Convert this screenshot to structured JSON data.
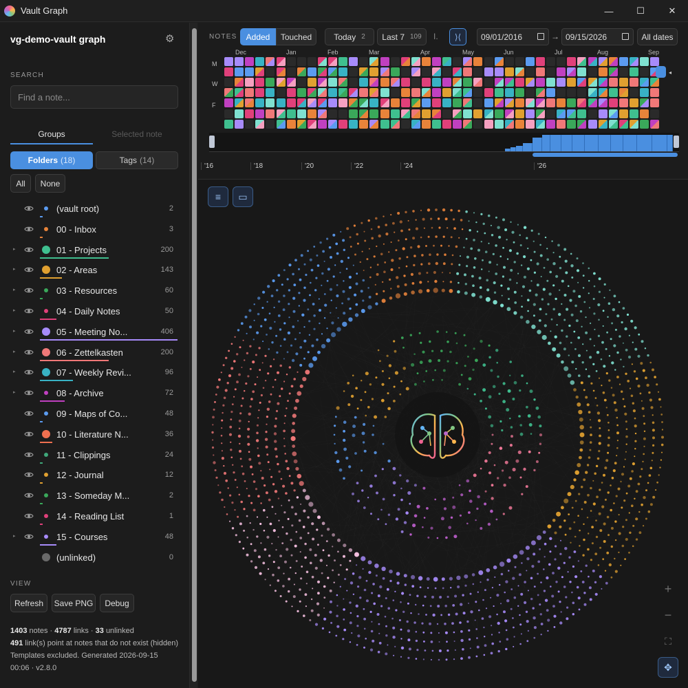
{
  "window": {
    "title": "Vault Graph",
    "min": "—",
    "max": "☐",
    "close": "✕"
  },
  "sidebar": {
    "vault_title": "vg-demo-vault graph",
    "search": {
      "label": "SEARCH",
      "placeholder": "Find a note..."
    },
    "tabs": {
      "groups": "Groups",
      "selected": "Selected note"
    },
    "folders_btn": {
      "label": "Folders",
      "count": "(18)"
    },
    "tags_btn": {
      "label": "Tags",
      "count": "(14)"
    },
    "all_btn": "All",
    "none_btn": "None",
    "folders": [
      {
        "label": "(vault root)",
        "count": "2",
        "color": "#5b9bf0",
        "expandable": false,
        "dot": "small"
      },
      {
        "label": "00 - Inbox",
        "count": "3",
        "color": "#e8833a",
        "expandable": false,
        "dot": "small"
      },
      {
        "label": "01 - Projects",
        "count": "200",
        "color": "#3fbf8f",
        "expandable": true,
        "dot": "big"
      },
      {
        "label": "02 - Areas",
        "count": "143",
        "color": "#e0a030",
        "expandable": true,
        "dot": "big"
      },
      {
        "label": "03 - Resources",
        "count": "60",
        "color": "#3aa85a",
        "expandable": true,
        "dot": "small"
      },
      {
        "label": "04 - Daily Notes",
        "count": "50",
        "color": "#e0407a",
        "expandable": true,
        "dot": "small"
      },
      {
        "label": "05 - Meeting No...",
        "count": "406",
        "color": "#a78bfa",
        "expandable": true,
        "dot": "big"
      },
      {
        "label": "06 - Zettelkasten",
        "count": "200",
        "color": "#f07878",
        "expandable": true,
        "dot": "big"
      },
      {
        "label": "07 - Weekly Revi...",
        "count": "96",
        "color": "#38b2c4",
        "expandable": true,
        "dot": "big"
      },
      {
        "label": "08 - Archive",
        "count": "72",
        "color": "#c040c0",
        "expandable": true,
        "dot": "small"
      },
      {
        "label": "09 - Maps of Co...",
        "count": "48",
        "color": "#5b9bf0",
        "expandable": false,
        "dot": "small"
      },
      {
        "label": "10 - Literature N...",
        "count": "36",
        "color": "#f07050",
        "expandable": false,
        "dot": "big"
      },
      {
        "label": "11 - Clippings",
        "count": "24",
        "color": "#3fa87a",
        "expandable": false,
        "dot": "small"
      },
      {
        "label": "12 - Journal",
        "count": "12",
        "color": "#e0a030",
        "expandable": false,
        "dot": "small"
      },
      {
        "label": "13 - Someday M...",
        "count": "2",
        "color": "#3aa85a",
        "expandable": false,
        "dot": "small"
      },
      {
        "label": "14 - Reading List",
        "count": "1",
        "color": "#e0407a",
        "expandable": false,
        "dot": "small"
      },
      {
        "label": "15 - Courses",
        "count": "48",
        "color": "#a78bfa",
        "expandable": true,
        "dot": "small"
      },
      {
        "label": "(unlinked)",
        "count": "0",
        "color": "#6a6a6a",
        "expandable": false,
        "dot": "big",
        "no_eye": true
      }
    ],
    "view": {
      "label": "VIEW",
      "refresh": "Refresh",
      "save_png": "Save PNG",
      "debug": "Debug"
    },
    "stats": {
      "notes_n": "1403",
      "notes": "notes",
      "dot": "·",
      "links_n": "4787",
      "links": "links",
      "unlinked_n": "33",
      "unlinked": "unlinked",
      "missing_n": "491",
      "missing": "link(s) point at notes that do not exist (hidden)",
      "footer": "Templates excluded. Generated 2026-09-15 00:06 · v2.8.0"
    }
  },
  "toolbar": {
    "notes_label": "NOTES",
    "added": "Added",
    "touched": "Touched",
    "today": {
      "label": "Today",
      "count": "2"
    },
    "last7": {
      "label": "Last 7",
      "count": "109"
    },
    "pipe": "I.",
    "collapse": "⟩⟨",
    "date_from": "09/01/2016",
    "arrow": "→",
    "date_to": "09/15/2026",
    "all_dates": "All dates"
  },
  "heatmap": {
    "months": [
      "Dec",
      "Jan",
      "Feb",
      "Mar",
      "Apr",
      "May",
      "Jun",
      "Jul",
      "Aug",
      "Sep"
    ],
    "days": [
      "M",
      "W",
      "F"
    ],
    "years": [
      "'16",
      "'18",
      "'20",
      "'22",
      "'24",
      "'26"
    ]
  },
  "graph": {
    "list_icon": "≡",
    "panel_icon": "▭",
    "zoom_in": "+",
    "zoom_out": "−",
    "fit": "⛶",
    "pan": "✥"
  },
  "colors": {
    "accent": "#4a8fe0",
    "palette": [
      "#5b9bf0",
      "#e8833a",
      "#3fbf8f",
      "#e0a030",
      "#3aa85a",
      "#e0407a",
      "#a78bfa",
      "#f07878",
      "#38b2c4",
      "#c040c0",
      "#f5a0c0",
      "#7fe0d0"
    ]
  }
}
